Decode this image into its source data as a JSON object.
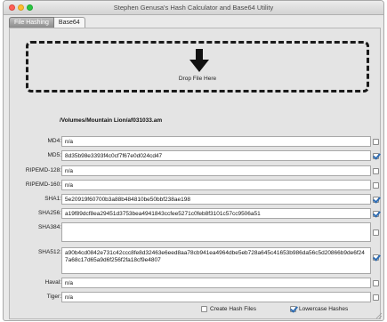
{
  "window": {
    "title": "Stephen Genusa's Hash Calculator and Base64 Utility"
  },
  "tabs": [
    {
      "label": "File Hashing",
      "active": true
    },
    {
      "label": "Base64",
      "active": false
    }
  ],
  "drop_zone": {
    "label": "Drop File Here",
    "icon": "down-arrow-icon"
  },
  "file_path": "/Volumes/Mountain Lion/af031033.am",
  "hashes": [
    {
      "label": "MD4:",
      "value": "n/a",
      "checked": false
    },
    {
      "label": "MD5:",
      "value": "8d35b98e3393f4c0cf7f67e0d024cd47",
      "checked": true
    },
    {
      "label": "RIPEMD-128:",
      "value": "n/a",
      "checked": false
    },
    {
      "label": "RIPEMD-160:",
      "value": "n/a",
      "checked": false
    },
    {
      "label": "SHA1:",
      "value": "5e20919f60700b3a88b484810be50bbf238ae198",
      "checked": true
    },
    {
      "label": "SHA256:",
      "value": "a19f89dcf8ea29451d3753bea4941843ccfee5271c0feb8f3101c57cc9506a51",
      "checked": true
    },
    {
      "label": "SHA384:",
      "value": "",
      "checked": false
    },
    {
      "label": "SHA512:",
      "value": "a90b4cd0842e731c42ccc8fe8d32463e6eed8aa78cb941ea4964dbe5eb728a645c41653b986da56c5d20866b9de6f247a68c17d65a9d6f256f2fa18cf9e4807",
      "checked": true
    },
    {
      "label": "Haval:",
      "value": "n/a",
      "checked": false
    },
    {
      "label": "Tiger:",
      "value": "n/a",
      "checked": false
    }
  ],
  "options": {
    "create_hash_files": {
      "label": "Create Hash Files",
      "checked": false
    },
    "lowercase_hashes": {
      "label": "Lowercase Hashes",
      "checked": true
    }
  },
  "colors": {
    "checkmark": "#2f6db3",
    "dash_border": "#1a1a1a"
  }
}
